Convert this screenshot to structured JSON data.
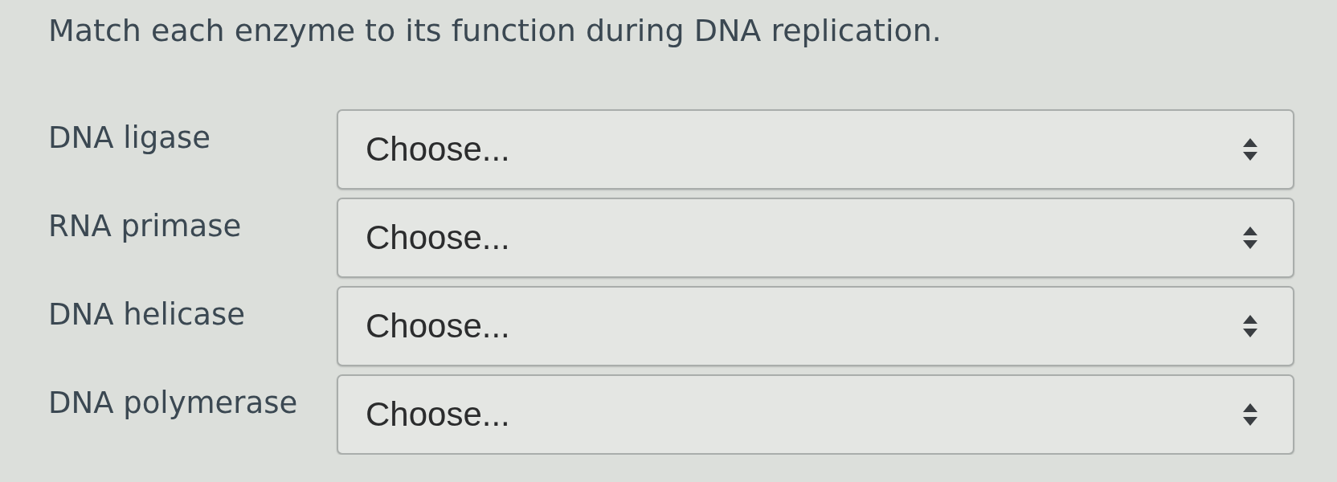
{
  "question": {
    "prompt": "Match each enzyme to its function during DNA replication."
  },
  "matches": [
    {
      "term": "DNA ligase",
      "dropdown": {
        "value": "Choose..."
      }
    },
    {
      "term": "RNA primase",
      "dropdown": {
        "value": "Choose..."
      }
    },
    {
      "term": "DNA helicase",
      "dropdown": {
        "value": "Choose..."
      }
    },
    {
      "term": "DNA polymerase",
      "dropdown": {
        "value": "Choose..."
      }
    }
  ]
}
